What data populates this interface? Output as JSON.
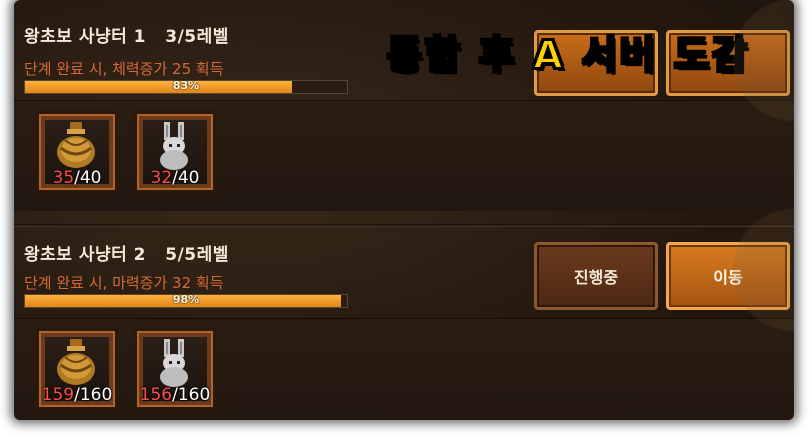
{
  "overlay_title": "통합 후 A 서버 도감",
  "rows": [
    {
      "title": "왕초보 사냥터 1   3/5레벨",
      "reward": "단계 완료 시, 체력증가 25 획득",
      "progress_label": "83%",
      "progress": 0.83,
      "items": [
        {
          "icon": "acorn-bag-icon",
          "current": "35",
          "total": "/40"
        },
        {
          "icon": "rabbit-icon",
          "current": "32",
          "total": "/40"
        }
      ]
    },
    {
      "title": "왕초보 사냥터 2   5/5레벨",
      "reward": "단계 완료 시, 마력증가 32 획득",
      "progress_label": "98%",
      "progress": 0.98,
      "items": [
        {
          "icon": "acorn-bag-icon",
          "current": "159",
          "total": "/160"
        },
        {
          "icon": "rabbit-icon",
          "current": "156",
          "total": "/160"
        }
      ],
      "buttons": {
        "in_progress": "진행중",
        "move": "이동"
      }
    }
  ],
  "colors": {
    "accent_orange": "#e1861a",
    "reward_text": "#d46a36",
    "count_current": "#ff4d4d",
    "title_yellow": "#ffd200"
  }
}
